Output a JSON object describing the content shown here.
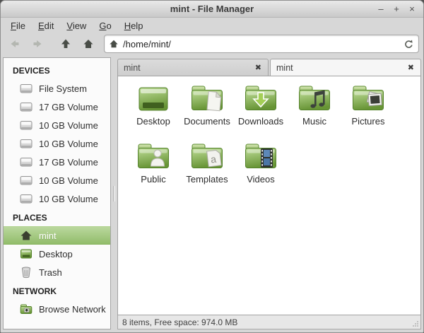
{
  "window": {
    "title": "mint - File Manager",
    "controls": {
      "minimize": "–",
      "maximize": "+",
      "close": "×"
    }
  },
  "menubar": {
    "items": [
      {
        "label": "File"
      },
      {
        "label": "Edit"
      },
      {
        "label": "View"
      },
      {
        "label": "Go"
      },
      {
        "label": "Help"
      }
    ]
  },
  "toolbar": {
    "path_value": "/home/mint/"
  },
  "sidebar": {
    "devices": {
      "header": "DEVICES",
      "items": [
        "File System",
        "17 GB Volume",
        "10 GB Volume",
        "10 GB Volume",
        "17 GB Volume",
        "10 GB Volume",
        "10 GB Volume"
      ]
    },
    "places": {
      "header": "PLACES",
      "items": [
        "mint",
        "Desktop",
        "Trash"
      ],
      "selected_item": "mint"
    },
    "network": {
      "header": "NETWORK",
      "items": [
        "Browse Network"
      ]
    }
  },
  "tabs": {
    "close_glyph": "✖",
    "items": [
      {
        "label": "mint",
        "active": false
      },
      {
        "label": "mint",
        "active": true
      }
    ]
  },
  "files": {
    "items": [
      {
        "label": "Desktop"
      },
      {
        "label": "Documents"
      },
      {
        "label": "Downloads"
      },
      {
        "label": "Music"
      },
      {
        "label": "Pictures"
      },
      {
        "label": "Public"
      },
      {
        "label": "Templates"
      },
      {
        "label": "Videos"
      }
    ]
  },
  "statusbar": {
    "text": "8 items, Free space: 974.0 MB"
  },
  "colors": {
    "selection_green": "#92bc6b",
    "folder_green": "#7aa844",
    "titlebar_text": "#3b3b3b",
    "video_blue": "#5d88b8"
  }
}
